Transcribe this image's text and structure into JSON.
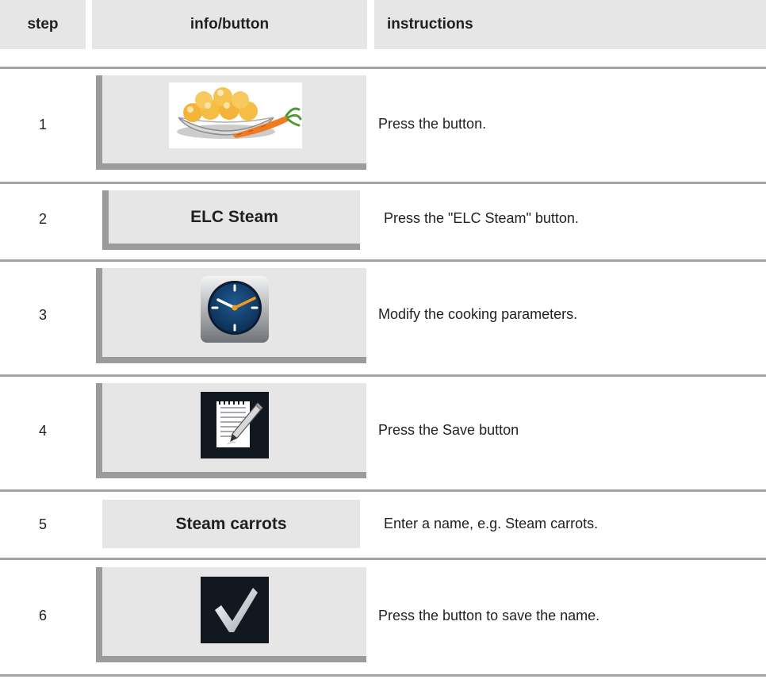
{
  "header": {
    "step": "step",
    "info_button": "info/button",
    "instructions": "instructions"
  },
  "rows": [
    {
      "step": "1",
      "icon": "vegetables-icon",
      "instruction": "Press the button."
    },
    {
      "step": "2",
      "button_label": "ELC Steam",
      "instruction": "Press the \"ELC Steam\" button."
    },
    {
      "step": "3",
      "icon": "clock-icon",
      "instruction": "Modify the cooking parameters."
    },
    {
      "step": "4",
      "icon": "edit-note-icon",
      "instruction": "Press the Save button"
    },
    {
      "step": "5",
      "button_label": "Steam carrots",
      "instruction": "Enter a name, e.g. Steam carrots."
    },
    {
      "step": "6",
      "icon": "checkmark-icon",
      "instruction": "Press the button to save the name."
    }
  ],
  "colors": {
    "header_bg": "#e6e6e7",
    "button_bg": "#e6e6e7",
    "button_shadow": "#9b9b9d",
    "separator": "#a3a3a5",
    "clock_orange": "#f39a1e",
    "icon_dark": "#111820"
  }
}
